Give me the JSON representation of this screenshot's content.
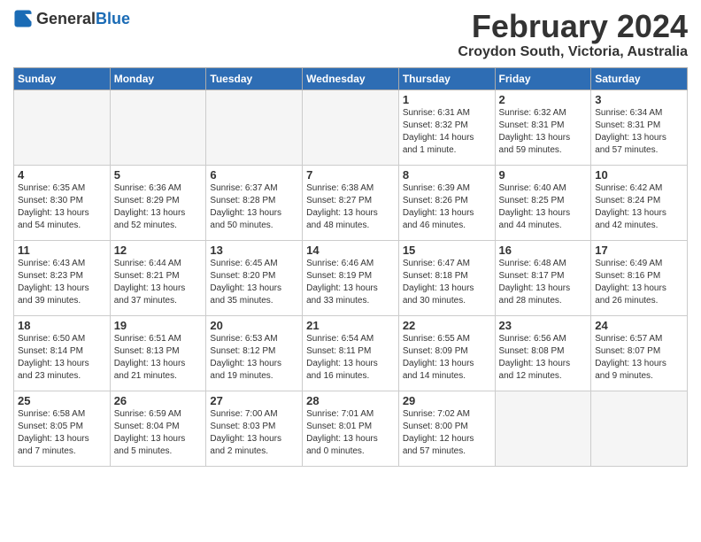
{
  "header": {
    "logo_general": "General",
    "logo_blue": "Blue",
    "title": "February 2024",
    "location": "Croydon South, Victoria, Australia"
  },
  "weekdays": [
    "Sunday",
    "Monday",
    "Tuesday",
    "Wednesday",
    "Thursday",
    "Friday",
    "Saturday"
  ],
  "weeks": [
    [
      {
        "day": "",
        "info": ""
      },
      {
        "day": "",
        "info": ""
      },
      {
        "day": "",
        "info": ""
      },
      {
        "day": "",
        "info": ""
      },
      {
        "day": "1",
        "info": "Sunrise: 6:31 AM\nSunset: 8:32 PM\nDaylight: 14 hours\nand 1 minute."
      },
      {
        "day": "2",
        "info": "Sunrise: 6:32 AM\nSunset: 8:31 PM\nDaylight: 13 hours\nand 59 minutes."
      },
      {
        "day": "3",
        "info": "Sunrise: 6:34 AM\nSunset: 8:31 PM\nDaylight: 13 hours\nand 57 minutes."
      }
    ],
    [
      {
        "day": "4",
        "info": "Sunrise: 6:35 AM\nSunset: 8:30 PM\nDaylight: 13 hours\nand 54 minutes."
      },
      {
        "day": "5",
        "info": "Sunrise: 6:36 AM\nSunset: 8:29 PM\nDaylight: 13 hours\nand 52 minutes."
      },
      {
        "day": "6",
        "info": "Sunrise: 6:37 AM\nSunset: 8:28 PM\nDaylight: 13 hours\nand 50 minutes."
      },
      {
        "day": "7",
        "info": "Sunrise: 6:38 AM\nSunset: 8:27 PM\nDaylight: 13 hours\nand 48 minutes."
      },
      {
        "day": "8",
        "info": "Sunrise: 6:39 AM\nSunset: 8:26 PM\nDaylight: 13 hours\nand 46 minutes."
      },
      {
        "day": "9",
        "info": "Sunrise: 6:40 AM\nSunset: 8:25 PM\nDaylight: 13 hours\nand 44 minutes."
      },
      {
        "day": "10",
        "info": "Sunrise: 6:42 AM\nSunset: 8:24 PM\nDaylight: 13 hours\nand 42 minutes."
      }
    ],
    [
      {
        "day": "11",
        "info": "Sunrise: 6:43 AM\nSunset: 8:23 PM\nDaylight: 13 hours\nand 39 minutes."
      },
      {
        "day": "12",
        "info": "Sunrise: 6:44 AM\nSunset: 8:21 PM\nDaylight: 13 hours\nand 37 minutes."
      },
      {
        "day": "13",
        "info": "Sunrise: 6:45 AM\nSunset: 8:20 PM\nDaylight: 13 hours\nand 35 minutes."
      },
      {
        "day": "14",
        "info": "Sunrise: 6:46 AM\nSunset: 8:19 PM\nDaylight: 13 hours\nand 33 minutes."
      },
      {
        "day": "15",
        "info": "Sunrise: 6:47 AM\nSunset: 8:18 PM\nDaylight: 13 hours\nand 30 minutes."
      },
      {
        "day": "16",
        "info": "Sunrise: 6:48 AM\nSunset: 8:17 PM\nDaylight: 13 hours\nand 28 minutes."
      },
      {
        "day": "17",
        "info": "Sunrise: 6:49 AM\nSunset: 8:16 PM\nDaylight: 13 hours\nand 26 minutes."
      }
    ],
    [
      {
        "day": "18",
        "info": "Sunrise: 6:50 AM\nSunset: 8:14 PM\nDaylight: 13 hours\nand 23 minutes."
      },
      {
        "day": "19",
        "info": "Sunrise: 6:51 AM\nSunset: 8:13 PM\nDaylight: 13 hours\nand 21 minutes."
      },
      {
        "day": "20",
        "info": "Sunrise: 6:53 AM\nSunset: 8:12 PM\nDaylight: 13 hours\nand 19 minutes."
      },
      {
        "day": "21",
        "info": "Sunrise: 6:54 AM\nSunset: 8:11 PM\nDaylight: 13 hours\nand 16 minutes."
      },
      {
        "day": "22",
        "info": "Sunrise: 6:55 AM\nSunset: 8:09 PM\nDaylight: 13 hours\nand 14 minutes."
      },
      {
        "day": "23",
        "info": "Sunrise: 6:56 AM\nSunset: 8:08 PM\nDaylight: 13 hours\nand 12 minutes."
      },
      {
        "day": "24",
        "info": "Sunrise: 6:57 AM\nSunset: 8:07 PM\nDaylight: 13 hours\nand 9 minutes."
      }
    ],
    [
      {
        "day": "25",
        "info": "Sunrise: 6:58 AM\nSunset: 8:05 PM\nDaylight: 13 hours\nand 7 minutes."
      },
      {
        "day": "26",
        "info": "Sunrise: 6:59 AM\nSunset: 8:04 PM\nDaylight: 13 hours\nand 5 minutes."
      },
      {
        "day": "27",
        "info": "Sunrise: 7:00 AM\nSunset: 8:03 PM\nDaylight: 13 hours\nand 2 minutes."
      },
      {
        "day": "28",
        "info": "Sunrise: 7:01 AM\nSunset: 8:01 PM\nDaylight: 13 hours\nand 0 minutes."
      },
      {
        "day": "29",
        "info": "Sunrise: 7:02 AM\nSunset: 8:00 PM\nDaylight: 12 hours\nand 57 minutes."
      },
      {
        "day": "",
        "info": ""
      },
      {
        "day": "",
        "info": ""
      }
    ]
  ]
}
